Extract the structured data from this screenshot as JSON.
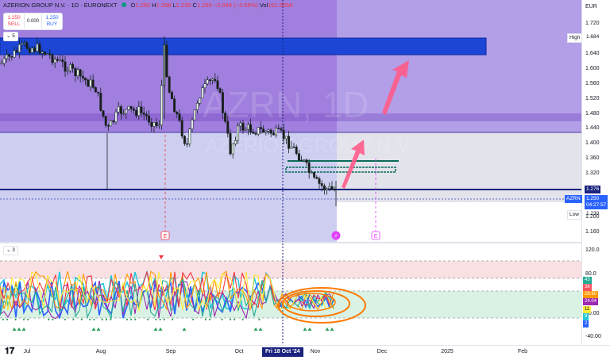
{
  "symbol": {
    "name": "AZERION GROUP N.V.",
    "interval": "1D",
    "exchange": "EURONEXT",
    "watermark_ticker": "AZRN, 1D",
    "watermark_name": "AZERION GROUP N.V."
  },
  "ohlc": {
    "open_label": "O",
    "open": "1.290",
    "high_label": "H",
    "high": "1.298",
    "low_label": "L",
    "low": "1.230",
    "close_label": "C",
    "close": "1.250",
    "change": "−0.046 (−3.55%)",
    "vol_label": "Vol",
    "vol": "101.505K"
  },
  "trade": {
    "sell_price": "1.250",
    "sell_label": "SELL",
    "spread": "0.000",
    "buy_price": "1.250",
    "buy_label": "BUY"
  },
  "pane_badges": {
    "main": "5",
    "indicator": "3"
  },
  "currency": "EUR",
  "price_axis": {
    "ticks": [
      "1.720",
      "1.684",
      "1.640",
      "1.600",
      "1.560",
      "1.520",
      "1.480",
      "1.440",
      "1.400",
      "1.360",
      "1.320",
      "1.276",
      "1.250",
      "1.230",
      "1.200",
      "1.160"
    ],
    "high_label": "High",
    "high_value": "1.684",
    "level_value": "1.276",
    "current_ticker": "AZRN",
    "current_value": "1.250",
    "countdown": "04:27:57",
    "low_label": "Low",
    "low_value": "1.230"
  },
  "indicator_axis": {
    "ticks": [
      "120.0",
      "80.0",
      "40.00",
      "-40.00"
    ],
    "values": [
      {
        "v": "43",
        "color": "#22ab94"
      },
      {
        "v": "36",
        "color": "#f7525f"
      },
      {
        "v": "28.60",
        "color": "#ff9800"
      },
      {
        "v": "24.04",
        "color": "#9c27b0"
      },
      {
        "v": "11",
        "color": "#ffeb3b"
      },
      {
        "v": "9",
        "color": "#26c6da"
      },
      {
        "v": "2",
        "color": "#2962ff"
      }
    ]
  },
  "time_axis": {
    "labels": [
      "Jul",
      "Aug",
      "Sep",
      "Oct",
      "Nov",
      "Dec",
      "2025",
      "Feb"
    ],
    "crosshair_label": "Fri 18 Oct '24"
  },
  "markers": {
    "earnings": "E"
  },
  "colors": {
    "up": "#089981",
    "down": "#f23645",
    "zone_purple": "#7e57c2",
    "zone_blue": "#1848cc",
    "accent_arrow": "#ff5b8a",
    "crosshair": "#1a237e"
  }
}
